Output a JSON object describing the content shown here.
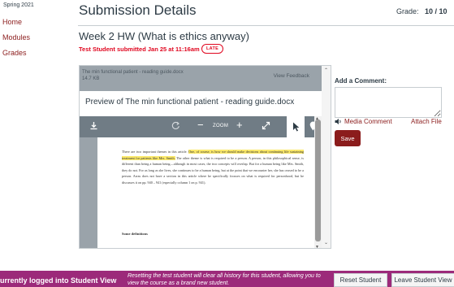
{
  "sidebar": {
    "term": "Spring 2021",
    "items": [
      {
        "label": "Home"
      },
      {
        "label": "Modules"
      },
      {
        "label": "Grades"
      }
    ]
  },
  "header": {
    "title": "Submission Details",
    "grade_label": "Grade:",
    "grade_value": "10 / 10"
  },
  "assignment": {
    "title": "Week 2 HW (What is ethics anyway)",
    "submitted_text": "Test Student submitted Jan 25 at 11:16am",
    "late_badge": "LATE"
  },
  "viewer": {
    "file_name": "The min functional patient - reading guide.docx",
    "file_size": "14.7 KB",
    "view_feedback": "View Feedback",
    "preview_title": "Preview of The min functional patient - reading guide.docx",
    "toolbar": {
      "download_icon": "download-icon",
      "rotate_icon": "rotate-icon",
      "zoom_out": "−",
      "zoom_label": "ZOOM",
      "zoom_in": "+",
      "fullscreen_icon": "expand-icon",
      "select_icon": "pointer-icon",
      "annotate_icon": "pin-icon"
    },
    "document": {
      "para_part1": "There are two important themes in this article. ",
      "para_highlight": "One, of course, is how we should make decisions about continuing life sustaining treatment for patients like Mrs. Smith.",
      "para_part2": " The other theme is what is required to be a person. A person, in this philosophical sense, is different than being a human being—although in most cases, the two concepts will overlap. But for a human being like Mrs. Smith, they do not. For as long as she lives, she continues to be a human being, but at the point that we encounter her, she has ceased to be a person. Arras does not have a section in this article where he specifically focuses on what is required for personhood, but he discusses it on pp. 940 – 941 (especially column 1 on p. 941).",
      "definitions_heading": "Some definitions"
    }
  },
  "comment": {
    "label": "Add a Comment:",
    "placeholder": "",
    "media_comment": "Media Comment",
    "attach_file": "Attach File",
    "save": "Save"
  },
  "student_view_bar": {
    "status": "urrently logged into Student View",
    "message": "Resetting the test student will clear all history for this student, allowing you to view the course as a brand new student.",
    "reset_button": "Reset Student",
    "leave_button": "Leave Student View"
  },
  "colors": {
    "link": "#8b1c1c",
    "late": "#e0061f",
    "save_button": "#8b1c1c",
    "student_view_bar": "#9c2a7a",
    "highlight": "#fbe96b"
  }
}
